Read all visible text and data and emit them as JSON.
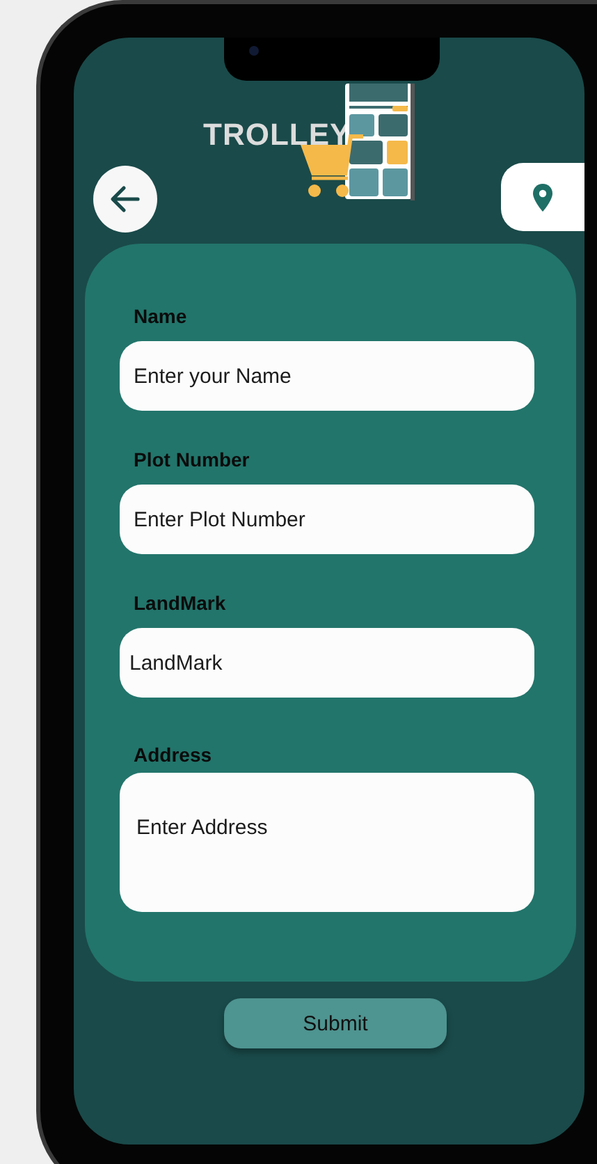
{
  "header": {
    "logo_text": "TROLLEY"
  },
  "form": {
    "fields": [
      {
        "label": "Name",
        "placeholder": "Enter your Name",
        "kind": "single"
      },
      {
        "label": "Plot Number",
        "placeholder": "Enter Plot Number",
        "kind": "single"
      },
      {
        "label": "LandMark",
        "placeholder": "LandMark",
        "kind": "single"
      },
      {
        "label": "Address",
        "placeholder": "Enter Address",
        "kind": "multiline"
      }
    ]
  },
  "submit_button": "Submit"
}
